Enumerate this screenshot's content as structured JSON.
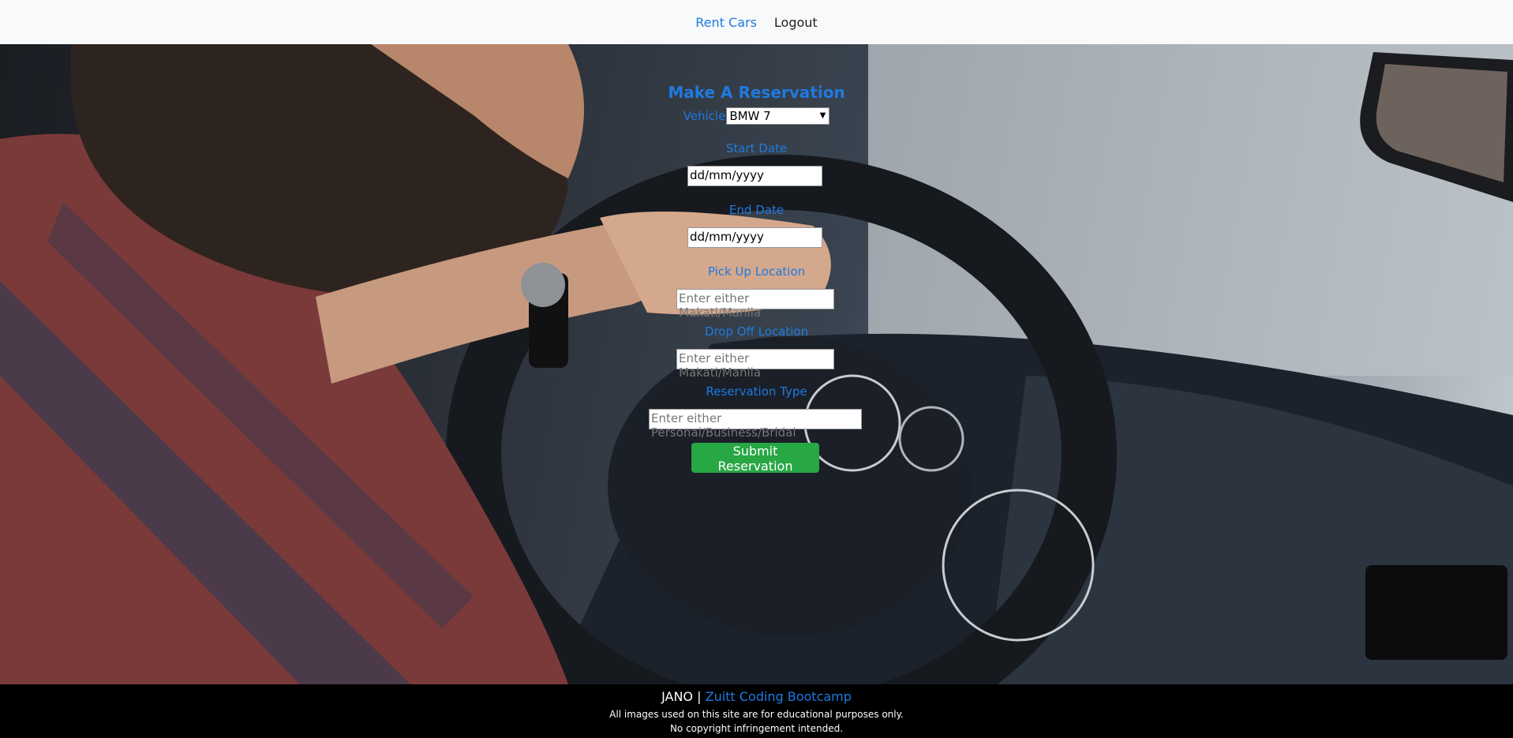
{
  "nav": {
    "rent_cars": "Rent Cars",
    "logout": "Logout"
  },
  "form": {
    "title": "Make A Reservation",
    "vehicle_label": "Vehicle",
    "vehicle_selected": "BMW 7",
    "start_date_label": "Start Date",
    "start_date_value": "dd/mm/yyyy",
    "end_date_label": "End Date",
    "end_date_value": "dd/mm/yyyy",
    "pickup_label": "Pick Up Location",
    "pickup_placeholder": "Enter either Makati/Manila",
    "dropoff_label": "Drop Off Location",
    "dropoff_placeholder": "Enter either Makati/Manila",
    "type_label": "Reservation Type",
    "type_placeholder": "Enter either Personal/Business/Bridal",
    "submit_label": "Submit Reservation"
  },
  "footer": {
    "brand": "JANO",
    "separator": "|",
    "link": "Zuitt Coding Bootcamp",
    "line2": "All images used on this site are for educational purposes only.",
    "line3": "No copyright infringement intended."
  },
  "colors": {
    "accent": "#1f7ae0",
    "submit": "#28a745",
    "footer_bg": "#000000",
    "nav_bg": "#f8f9fa"
  }
}
